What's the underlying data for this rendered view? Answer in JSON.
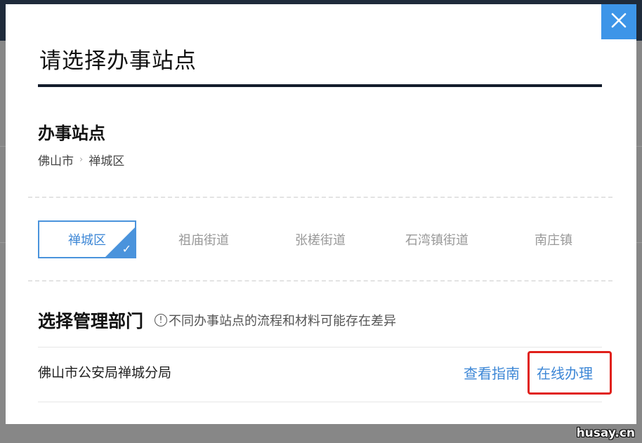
{
  "modal": {
    "title": "请选择办事站点",
    "close_glyph": "✕"
  },
  "site": {
    "heading": "办事站点",
    "breadcrumb": [
      "佛山市",
      "禅城区"
    ],
    "breadcrumb_sep": "›"
  },
  "tabs": [
    {
      "label": "禅城区",
      "active": true
    },
    {
      "label": "祖庙街道",
      "active": false
    },
    {
      "label": "张槎街道",
      "active": false
    },
    {
      "label": "石湾镇街道",
      "active": false
    },
    {
      "label": "南庄镇",
      "active": false
    }
  ],
  "check_glyph": "✓",
  "department": {
    "heading": "选择管理部门",
    "info_glyph": "!",
    "note": "不同办事站点的流程和材料可能存在差异",
    "rows": [
      {
        "name": "佛山市公安局禅城分局",
        "guide_label": "查看指南",
        "online_label": "在线办理"
      }
    ]
  },
  "watermark": "husay.cn",
  "colors": {
    "accent": "#3d87d6",
    "close_bg": "#3d95e8",
    "highlight": "#e0201a",
    "title_rule": "#131c2b"
  }
}
